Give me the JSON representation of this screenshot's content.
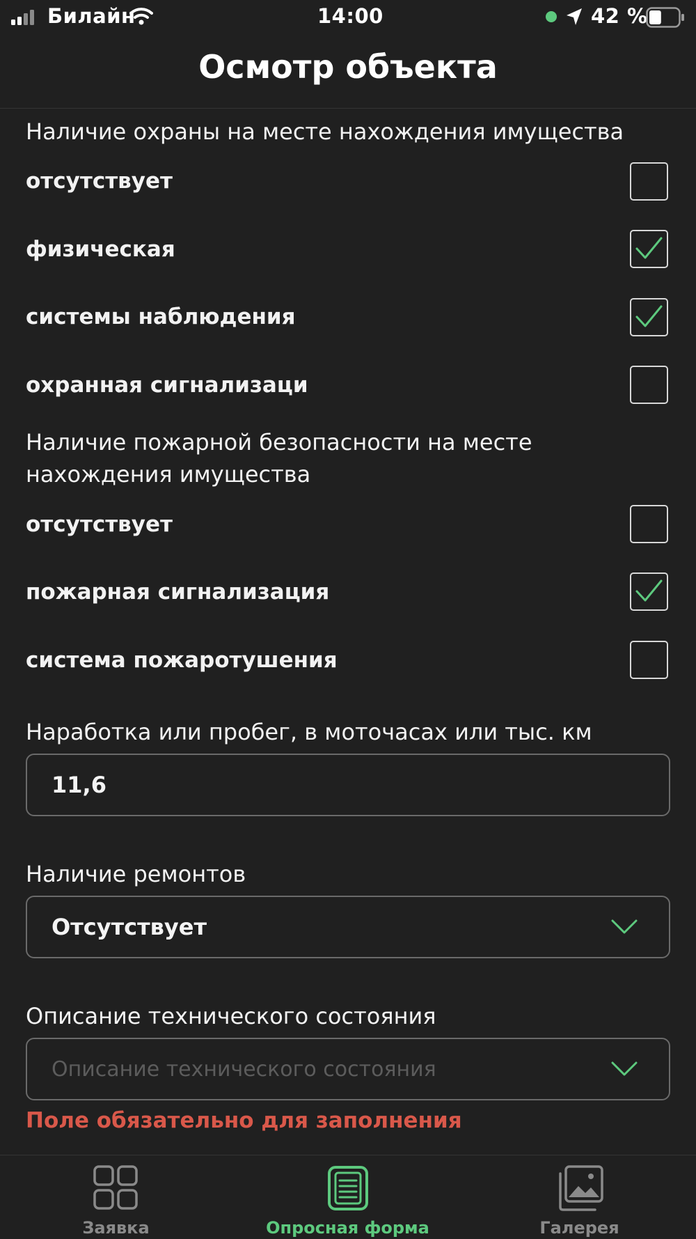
{
  "status_bar": {
    "carrier": "Билайн",
    "time": "14:00",
    "battery": "42 %",
    "battery_level": 0.42
  },
  "header": {
    "title": "Осмотр объекта"
  },
  "security_section": {
    "title": "Наличие охраны на месте нахождения имущества",
    "options": [
      {
        "label": "отсутствует",
        "checked": false
      },
      {
        "label": "физическая",
        "checked": true
      },
      {
        "label": "системы наблюдения",
        "checked": true
      },
      {
        "label": "охранная сигнализаци",
        "checked": false
      }
    ]
  },
  "fire_section": {
    "title": "Наличие пожарной безопасности на месте нахождения имущества",
    "options": [
      {
        "label": "отсутствует",
        "checked": false
      },
      {
        "label": "пожарная сигнализация",
        "checked": true
      },
      {
        "label": "система пожаротушения",
        "checked": false
      }
    ]
  },
  "mileage": {
    "label": "Наработка или пробег, в моточасах или тыс. км",
    "value": "11,6"
  },
  "repairs": {
    "label": "Наличие ремонтов",
    "value": "Отсутствует"
  },
  "tech_condition": {
    "label": "Описание технического состояния",
    "placeholder": "Описание технического состояния",
    "error": "Поле обязательно для заполнения"
  },
  "tabbar": {
    "tabs": [
      {
        "label": "Заявка",
        "icon": "grid-icon",
        "active": false
      },
      {
        "label": "Опросная форма",
        "icon": "document-list-icon",
        "active": true
      },
      {
        "label": "Галерея",
        "icon": "gallery-icon",
        "active": false
      }
    ]
  },
  "colors": {
    "background": "#202020",
    "accent": "#5dc97e",
    "error": "#d9584a",
    "inactive_tab": "#8a8a8a"
  }
}
